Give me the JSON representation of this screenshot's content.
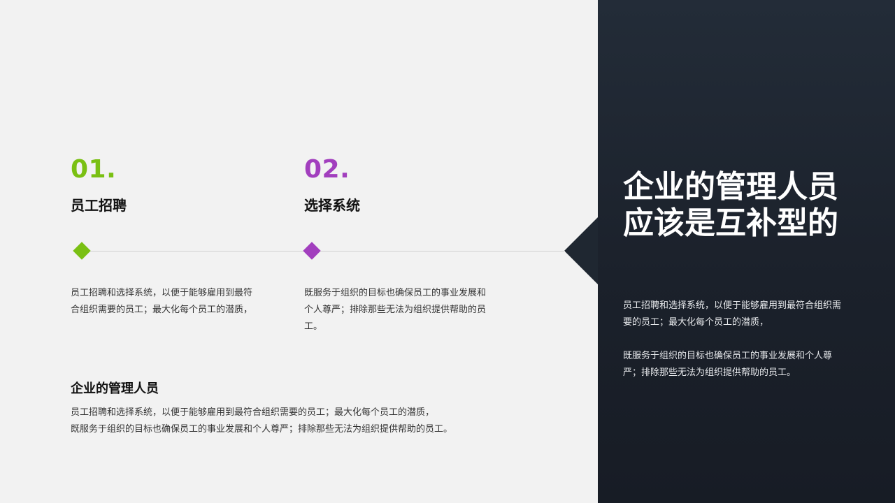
{
  "items": [
    {
      "number": "01.",
      "title": "员工招聘",
      "description": "员工招聘和选择系统，以便于能够雇用到最符合组织需要的员工；最大化每个员工的潜质，"
    },
    {
      "number": "02.",
      "title": "选择系统",
      "description": "既服务于组织的目标也确保员工的事业发展和个人尊严；排除那些无法为组织提供帮助的员工。"
    }
  ],
  "summary": {
    "title": "企业的管理人员",
    "lines": [
      "员工招聘和选择系统，以便于能够雇用到最符合组织需要的员工；最大化每个员工的潜质，",
      "既服务于组织的目标也确保员工的事业发展和个人尊严；排除那些无法为组织提供帮助的员工。"
    ]
  },
  "right": {
    "heading_lines": [
      "企业的管理人员",
      "应该是互补型的"
    ],
    "paragraphs": [
      "员工招聘和选择系统，以便于能够雇用到最符合组织需要的员工；最大化每个员工的潜质，",
      "既服务于组织的目标也确保员工的事业发展和个人尊严；排除那些无法为组织提供帮助的员工。"
    ]
  },
  "colors": {
    "accent_green": "#7ac013",
    "accent_purple": "#a23fbe",
    "dark_panel": "#1b212b",
    "light_bg": "#f2f2f2"
  }
}
